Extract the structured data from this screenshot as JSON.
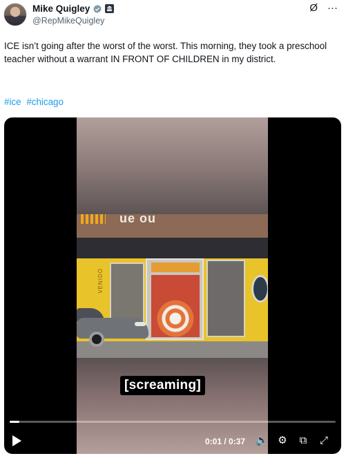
{
  "author": {
    "name": "Mike Quigley",
    "handle": "@RepMikeQuigley",
    "verified": true,
    "verified_color": "#829aab",
    "badge_icon": "government-badge-icon",
    "avatar_icon": "profile-photo"
  },
  "top_actions": {
    "grok_icon": "Ø",
    "more_icon": "···"
  },
  "tweet": {
    "text": "ICE isn’t going after the worst of the worst. This morning, they took a preschool teacher without a warrant IN FRONT OF CHILDREN in my district.",
    "hashtags": [
      "#ice",
      "#chicago"
    ],
    "hashtag_color": "#1d9bf0"
  },
  "video": {
    "sign_fragment": "ue ou",
    "window_text": "VENIDO",
    "caption": "[screaming]",
    "time": "0:01 / 0:37",
    "progress": 0.03,
    "controls": {
      "play_icon": "play-icon",
      "volume_icon": "🔈",
      "settings_icon": "⚙",
      "subtitles_icon": "⧉",
      "fullscreen_icon": "⤢"
    }
  }
}
